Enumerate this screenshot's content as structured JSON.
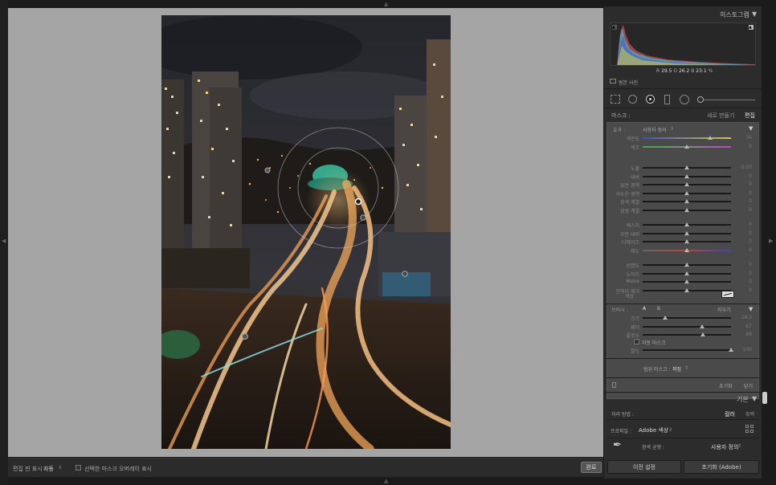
{
  "histogram": {
    "title": "히스토그램",
    "r_label": "R",
    "r_value": "29.5",
    "g_label": "G",
    "g_value": "26.2",
    "b_label": "B",
    "b_value": "23.1",
    "percent": "%",
    "original_photo": "원본 사진"
  },
  "mask": {
    "label": "마스크 :",
    "new_label": "새로 만들기",
    "edit_label": "편집",
    "effect_label": "효과 :",
    "effect_preset": "사용자 정의",
    "groups": [
      [
        {
          "name": "색온도",
          "value": "36",
          "pos": 0.76,
          "track": "temp"
        },
        {
          "name": "색조",
          "value": "0",
          "pos": 0.5,
          "track": "tint"
        }
      ],
      [
        {
          "name": "노출",
          "value": "0.00",
          "pos": 0.5,
          "track": "plain"
        },
        {
          "name": "대비",
          "value": "0",
          "pos": 0.5,
          "track": "plain"
        },
        {
          "name": "밝은 영역",
          "value": "0",
          "pos": 0.5,
          "track": "plain"
        },
        {
          "name": "어두운 영역",
          "value": "0",
          "pos": 0.5,
          "track": "plain"
        },
        {
          "name": "흰색 계열",
          "value": "0",
          "pos": 0.5,
          "track": "plain"
        },
        {
          "name": "검정 계열",
          "value": "0",
          "pos": 0.5,
          "track": "plain"
        }
      ],
      [
        {
          "name": "텍스처",
          "value": "0",
          "pos": 0.5,
          "track": "plain"
        },
        {
          "name": "부분 대비",
          "value": "0",
          "pos": 0.5,
          "track": "plain"
        },
        {
          "name": "디헤이즈",
          "value": "0",
          "pos": 0.5,
          "track": "plain"
        },
        {
          "name": "채도",
          "value": "0",
          "pos": 0.5,
          "track": "sat"
        }
      ],
      [
        {
          "name": "선명도",
          "value": "0",
          "pos": 0.5,
          "track": "plain"
        },
        {
          "name": "노이즈",
          "value": "0",
          "pos": 0.5,
          "track": "plain"
        },
        {
          "name": "Moire",
          "value": "0",
          "pos": 0.5,
          "track": "plain"
        },
        {
          "name": "언저리 제거",
          "value": "0",
          "pos": 0.5,
          "track": "plain"
        }
      ]
    ],
    "color_label": "색상",
    "brush": {
      "label": "브러시 :",
      "a_label": "A",
      "b_label": "B",
      "erase_label": "지우기",
      "sliders": [
        {
          "name": "크기",
          "value": "28.0",
          "pos": 0.25
        },
        {
          "name": "페더",
          "value": "67",
          "pos": 0.67
        },
        {
          "name": "플로우",
          "value": "68",
          "pos": 0.68
        }
      ],
      "auto_mask_label": "자동 마스크",
      "density": {
        "name": "밀도",
        "value": "100",
        "pos": 1.0
      }
    },
    "range_mask_label": "범위 마스크 :",
    "range_mask_value": "꺼짐",
    "reset_label": "초기화",
    "close_label": "닫기"
  },
  "basic": {
    "title": "기본",
    "treatment_label": "처리 방법 :",
    "color_option": "컬러",
    "bw_option": "흑백",
    "profile_label": "프로파일 :",
    "profile_value": "Adobe 색상",
    "wb_label": "흰색 균형 :",
    "wb_value": "사용자 정의"
  },
  "bottom_buttons": {
    "previous": "이전 설정",
    "reset": "초기화 (Adobe)"
  },
  "toolbar": {
    "show_edit_pins": "편집 핀 표시 :",
    "show_edit_pins_value": "자동",
    "overlay_label": "선택한 마스크 오버레이 표시",
    "done_label": "완료"
  },
  "colors": {
    "canvas_bg": "#a5a5a5",
    "panel_bg": "#2c2c2c",
    "mask_panel_bg": "#4a4a4a"
  }
}
